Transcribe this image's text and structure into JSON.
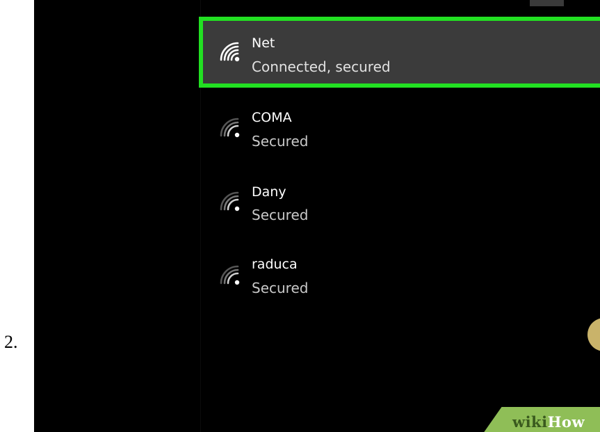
{
  "step": {
    "number": "2."
  },
  "networks": [
    {
      "name": "Net",
      "status": "Connected, secured",
      "selected": true,
      "icon": "wifi-signal-icon"
    },
    {
      "name": "COMA",
      "status": "Secured",
      "selected": false,
      "icon": "wifi-signal-icon"
    },
    {
      "name": "Dany",
      "status": "Secured",
      "selected": false,
      "icon": "wifi-signal-icon"
    },
    {
      "name": "raduca",
      "status": "Secured",
      "selected": false,
      "icon": "wifi-signal-icon"
    }
  ],
  "colors": {
    "highlight_border": "#22e022",
    "selected_background": "#3b3b3b",
    "screen_background": "#000000",
    "watermark_band": "#8fbe57"
  }
}
